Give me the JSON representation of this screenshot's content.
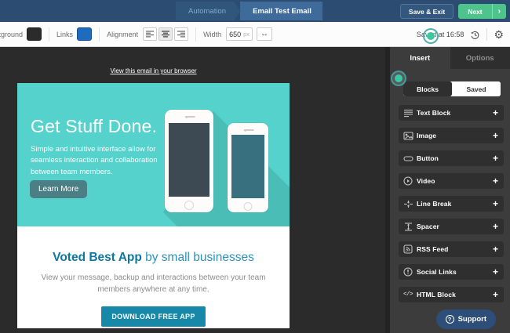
{
  "topbar": {
    "breadcrumb": {
      "parent": "Automation",
      "current": "Email Test Email"
    },
    "save_exit": "Save & Exit",
    "next": "Next"
  },
  "toolbar": {
    "background_label": "Background",
    "background_color": "#2b2b2b",
    "links_label": "Links",
    "links_color": "#1e6bc0",
    "alignment_label": "Alignment",
    "alignment_selected": "center",
    "width_label": "Width",
    "width_value": "650",
    "width_unit": "px",
    "saved_status": "Saved at 16:58"
  },
  "icons": {
    "resize": "↔",
    "settings": "⚙",
    "plus": "+",
    "next_caret": "›",
    "question": "?"
  },
  "canvas": {
    "view_in_browser": "View this email in your browser",
    "email": {
      "hero_title": "Get Stuff Done.",
      "hero_body": "Simple and intuitive interface allow for seamless interaction and collaboration between team members.",
      "hero_cta": "Learn More",
      "headline_strong": "Voted Best App",
      "headline_rest": " by small businesses",
      "lower_body": "View your message, backup and interactions between your team members anywhere at any time.",
      "lower_cta": "DOWNLOAD FREE APP",
      "hero_bg": "#55d2cc",
      "cta_bg": "#1888a9"
    }
  },
  "sidebar": {
    "tabs": [
      {
        "label": "Insert"
      },
      {
        "label": "Options"
      }
    ],
    "toggle": [
      {
        "label": "Blocks"
      },
      {
        "label": "Saved"
      }
    ],
    "blocks": [
      {
        "label": "Text Block"
      },
      {
        "label": "Image"
      },
      {
        "label": "Button"
      },
      {
        "label": "Video"
      },
      {
        "label": "Line Break"
      },
      {
        "label": "Spacer"
      },
      {
        "label": "RSS Feed"
      },
      {
        "label": "Social Links"
      },
      {
        "label": "HTML Block"
      }
    ],
    "html_glyph": "</>",
    "support": "Support"
  },
  "colors": {
    "topbar_blue": "#2c4d71",
    "next_green": "#4fc38c",
    "sidebar_gray": "#3c3c3c",
    "hotspot_teal": "#3cc6a1"
  }
}
